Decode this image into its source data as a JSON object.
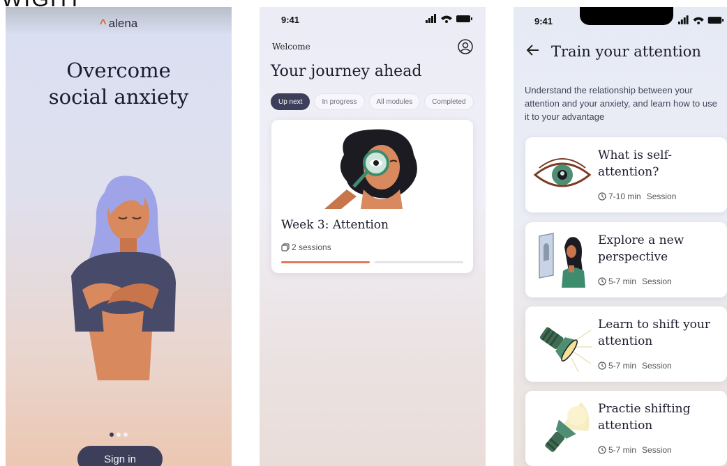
{
  "header_text": "WIGHT",
  "screen1": {
    "brand": "alena",
    "brand_mark": "^",
    "title_line1": "Overcome",
    "title_line2": "social anxiety",
    "signin_label": "Sign in"
  },
  "screen2": {
    "time": "9:41",
    "welcome": "Welcome",
    "title": "Your journey ahead",
    "chips": [
      "Up next",
      "In progress",
      "All modules",
      "Completed"
    ],
    "card": {
      "title": "Week 3: Attention",
      "sessions": "2 sessions",
      "progress": 0.5
    }
  },
  "screen3": {
    "time": "9:41",
    "title": "Train your attention",
    "description": "Understand the relationship between your attention and your anxiety, and learn how to use it to your advantage",
    "sessions": [
      {
        "title": "What is self-attention?",
        "duration": "7-10 min",
        "type": "Session"
      },
      {
        "title": "Explore a new perspective",
        "duration": "5-7 min",
        "type": "Session"
      },
      {
        "title": "Learn to shift your attention",
        "duration": "5-7 min",
        "type": "Session"
      },
      {
        "title": "Practie shifting attention",
        "duration": "5-7 min",
        "type": "Session"
      }
    ]
  },
  "colors": {
    "primary": "#3c3e5a",
    "accent": "#e27b55",
    "brand": "#e0623a"
  }
}
